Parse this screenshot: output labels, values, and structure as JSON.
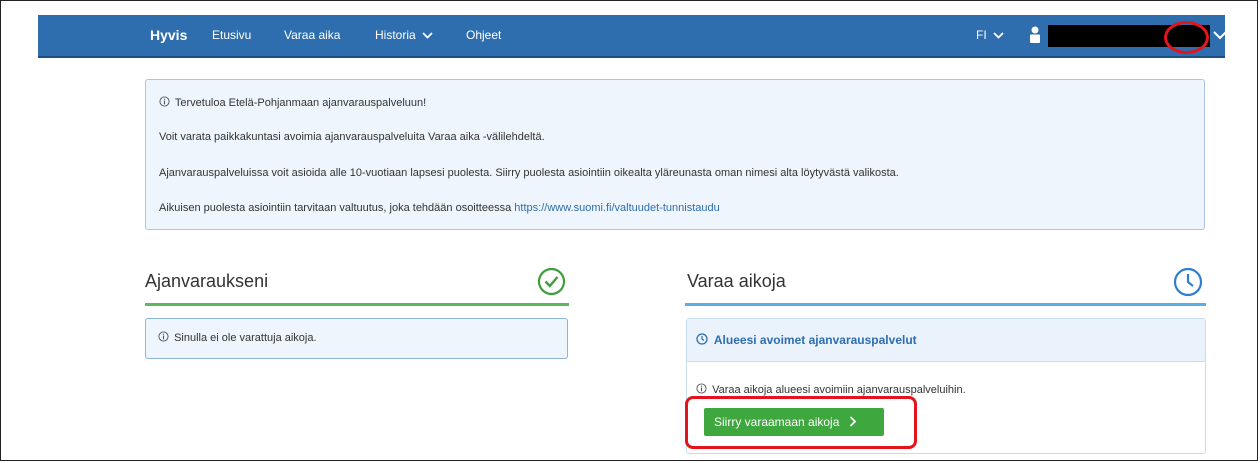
{
  "navbar": {
    "brand": "Hyvis",
    "items": [
      {
        "label": "Etusivu"
      },
      {
        "label": "Varaa aika"
      },
      {
        "label": "Historia"
      },
      {
        "label": "Ohjeet"
      }
    ],
    "language": "FI",
    "bg_color": "#2f6eae"
  },
  "info_box": {
    "welcome": "Tervetuloa Etelä-Pohjanmaan ajanvarauspalveluun!",
    "line2": "Voit varata paikkakuntasi avoimia ajanvarauspalveluita Varaa aika -välilehdeltä.",
    "line3": "Ajanvarauspalveluissa voit asioida alle 10-vuotiaan lapsesi puolesta. Siirry puolesta asiointiin oikealta yläreunasta oman nimesi alta löytyvästä valikosta.",
    "line4_prefix": "Aikuisen puolesta asiointiin tarvitaan valtuutus, joka tehdään osoitteessa",
    "line4_link": "https://www.suomi.fi/valtuudet-tunnistaudu"
  },
  "my_bookings": {
    "title": "Ajanvaraukseni",
    "empty_text": "Sinulla ei ole varattuja aikoja.",
    "accent_color": "#5cb85c"
  },
  "book_times": {
    "title": "Varaa aikoja",
    "card_title": "Alueesi avoimet ajanvarauspalvelut",
    "card_text": "Varaa aikoja alueesi avoimiin ajanvarauspalveluihin.",
    "button_label": "Siirry varaamaan aikoja",
    "accent_color": "#5aaee3",
    "button_color": "#3ea83e"
  },
  "icons": [
    "user-icon",
    "chevron-down-icon",
    "info-icon",
    "check-circle-icon",
    "clock-icon",
    "chevron-right-icon"
  ]
}
